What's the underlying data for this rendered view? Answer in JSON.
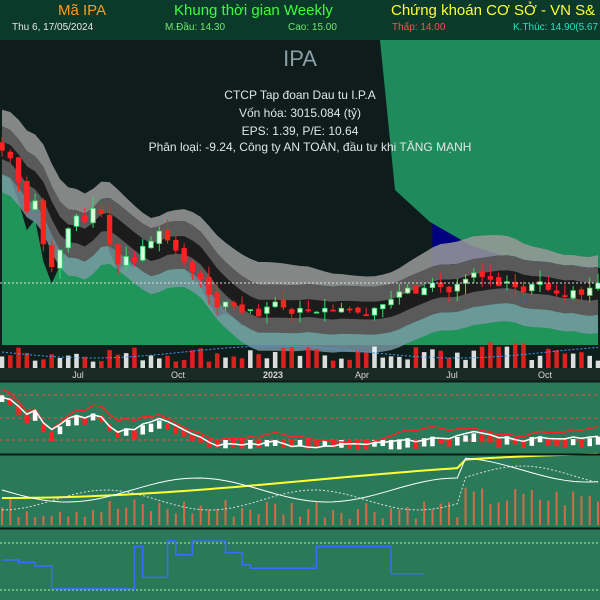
{
  "header": {
    "symbol_label": "Mã IPA",
    "timeframe_label": "Khung thời gian Weekly",
    "market_label": "Chứng khoán CƠ SỞ - VN S&",
    "date": "Thu 6, 17/05/2024",
    "open": "M.Đầu: 14.30",
    "high": "Cao: 15.00",
    "low": "Thấp: 14.00",
    "close": "K.Thúc: 14.90(5.67"
  },
  "info": {
    "ticker": "IPA",
    "company": "CTCP Tap đoan Dau tu I.P.A",
    "market_cap": "Vốn hóa: 3015.084 (tỷ)",
    "eps_pe": "EPS: 1.39, P/E: 10.64",
    "classification": "Phân loại: -9.24, Công ty AN TOÀN, đầu tư khi TĂNG MẠNH"
  },
  "colors": {
    "header_bg": "#0b3a2a",
    "orange": "#ff9a1a",
    "green": "#3cff3c",
    "yellow": "#ffff33",
    "dim_green": "#6ee86e",
    "red_text": "#ff5050",
    "cyan_text": "#28e0c8",
    "up": "#33dd66",
    "down": "#ff2222",
    "cloud_green": "#22aa66",
    "cloud_navy": "#000080",
    "cloud_dark": "#0f1c1c",
    "band_light": "#9a9a9a",
    "band_mid": "#5a5a5a",
    "band_dark": "#1c1c1c"
  },
  "chart_data": [
    {
      "type": "candlestick",
      "title": "IPA",
      "x_tick_labels": [
        "Jul",
        "Oct",
        "2023",
        "Apr",
        "Jul",
        "Oct"
      ],
      "ohlc_close": [
        25.4,
        24.8,
        22.9,
        20.6,
        21.4,
        18.0,
        16.2,
        17.5,
        19.2,
        20.2,
        19.8,
        20.8,
        20.4,
        18.0,
        16.4,
        17.0,
        16.6,
        17.8,
        18.2,
        19.0,
        18.3,
        17.5,
        16.6,
        15.8,
        15.2,
        14.0,
        13.0,
        13.4,
        13.1,
        12.6,
        12.8,
        12.3,
        13.0,
        13.4,
        13.0,
        12.5,
        12.9,
        12.7,
        12.6,
        12.9,
        12.7,
        12.9,
        12.8,
        12.6,
        12.4,
        12.9,
        13.2,
        13.6,
        14.2,
        14.5,
        14.1,
        14.5,
        14.9,
        14.6,
        14.2,
        14.8,
        15.2,
        15.7,
        15.4,
        15.2,
        14.7,
        15.0,
        14.6,
        14.2,
        14.8,
        15.0,
        14.4,
        14.1,
        13.9,
        14.3,
        14.0,
        14.5,
        14.9
      ],
      "last_close": 14.9,
      "y_axis": "not shown",
      "grid": false
    },
    {
      "type": "line",
      "note": "Oscillator panel with red/white lines and histogram bars",
      "y_axis": "not shown"
    },
    {
      "type": "line",
      "note": "Panel with yellow and white moving lines and volume-like bars",
      "y_axis": "not shown"
    },
    {
      "type": "line",
      "note": "Step signal panel with blue and orange steps",
      "y_axis": "not shown"
    }
  ]
}
